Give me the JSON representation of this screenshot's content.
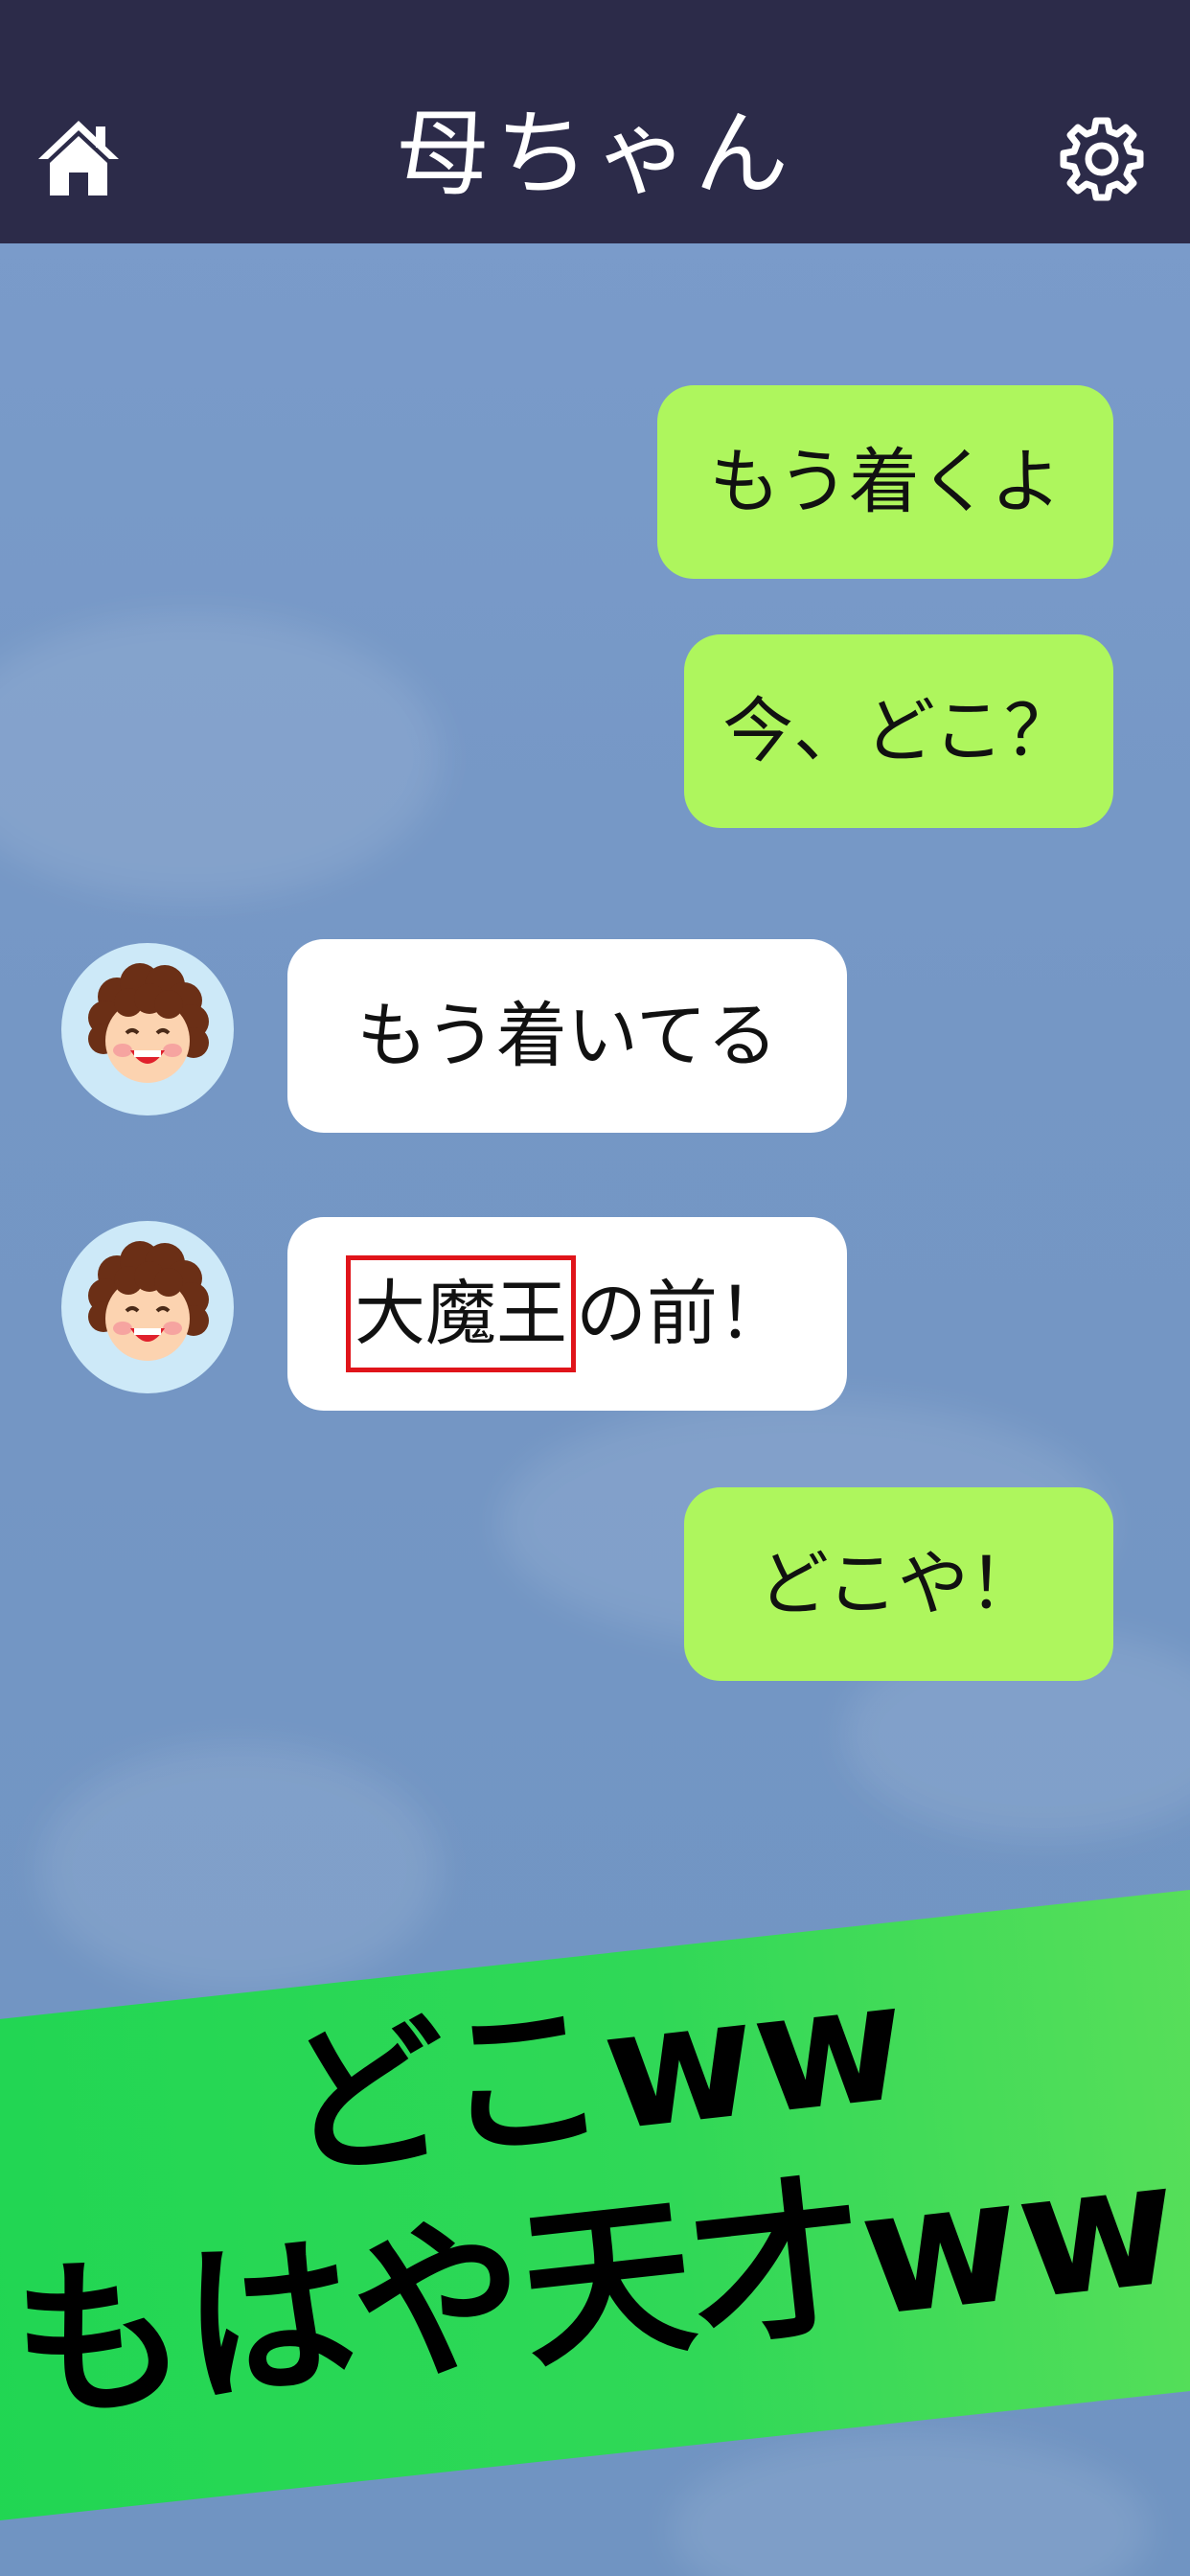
{
  "header": {
    "title": "母ちゃん",
    "home_icon": "home-icon",
    "settings_icon": "gear-icon",
    "background": "#2c2b49"
  },
  "messages": [
    {
      "from": "me",
      "text": "もう着くよ"
    },
    {
      "from": "me",
      "text": "今、どこ？"
    },
    {
      "from": "mother",
      "text": "もう着いてる"
    },
    {
      "from": "mother",
      "highlight": "大魔王",
      "text": "の前！"
    },
    {
      "from": "me",
      "text": "どこや！"
    }
  ],
  "banner": {
    "line1": "どこww",
    "line2": "もはや天才ww",
    "color": "#22d653"
  },
  "colors": {
    "my_bubble": "#aef65d",
    "their_bubble": "#ffffff",
    "highlight_border": "#e0141a"
  }
}
